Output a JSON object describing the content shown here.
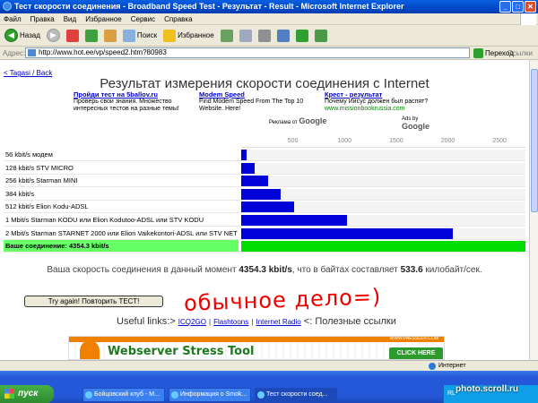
{
  "window": {
    "title": "Тест скорости соединения - Broadband Speed Test - Результат - Result - Microsoft Internet Explorer",
    "controls": {
      "minimize": "_",
      "maximize": "□",
      "close": "✕"
    }
  },
  "menu": [
    "Файл",
    "Правка",
    "Вид",
    "Избранное",
    "Сервис",
    "Справка"
  ],
  "toolbar": {
    "back": "Назад",
    "search": "Поиск",
    "favorites": "Избранное"
  },
  "address": {
    "label": "Адрес:",
    "url": "http://www.hot.ee/vp/speed2.htm?80983",
    "go": "Переход",
    "links": "Ссылки"
  },
  "page": {
    "back_link": "< Tagasi / Back",
    "heading": "Результат измерения скорости соединения с Internet",
    "ads": [
      {
        "title": "Пройди тест на 5ballov.ru",
        "text": "Проверь свои знания. Множество интересных тестов на разные темы!",
        "url": ""
      },
      {
        "title": "Modem Speed",
        "text": "Find Modem Speed From The Top 10 Website. Here!",
        "url": ""
      },
      {
        "title": "Крест - результат",
        "text": "Почему Иисус должен был распят?",
        "url": "www.missionbookrussia.com"
      }
    ],
    "ads_by_ru": "Реклама от",
    "ads_by_en": "Ads by",
    "google": "Google",
    "result_prefix": "Ваша скорость соединения в данный момент",
    "result_speed": "4354.3 kbit/s",
    "result_middle": ", что в байтах составляет",
    "result_bytes": "533.6",
    "result_suffix": "килобайт/сек.",
    "retry_button": "Try again! Повторить ТЕСТ!",
    "useful_label": "Useful links:>",
    "useful_links": [
      "ICQ2GO",
      "Flashtoons",
      "Internet Radio"
    ],
    "useful_suffix": "<: Полезные ссылки",
    "handwriting": "обычное дело=)",
    "banner": {
      "title": "Webserver Stress Tool",
      "cta": "CLICK HERE",
      "site": "WWW.PAESSLER.COM"
    }
  },
  "chart_data": {
    "type": "bar",
    "orientation": "horizontal",
    "xlim": [
      0,
      2750
    ],
    "ticks": [
      500,
      1000,
      1500,
      2000,
      2500
    ],
    "categories": [
      "56 kbit/s модем",
      "128 kbit/s STV MICRO",
      "256 kbit/s Starman MINI",
      "384 kbit/s",
      "512 kbit/s Elion Kodu-ADSL",
      "1 Mbit/s Starman KODU или Elion Kodutoo-ADSL или STV KODU",
      "2 Mbit/s Starman STARNET 2000 или Elion Vaikekontori-ADSL или STV NET",
      "Ваше соединение: 4354.3 kbit/s"
    ],
    "values": [
      56,
      128,
      256,
      384,
      512,
      1024,
      2048,
      4354.3
    ],
    "colors": {
      "bar": "#0000d8",
      "mine": "#00dd00",
      "mine_label_bg": "#66ff66"
    }
  },
  "status": {
    "text": "",
    "zone": "Интернет"
  },
  "taskbar": {
    "start": "пуск",
    "tasks": [
      "Бойцовский клуб - М...",
      "Информация о Smok...",
      "Тест скорости соед..."
    ],
    "tray": "RL"
  },
  "watermark": "photo.scroll.ru"
}
